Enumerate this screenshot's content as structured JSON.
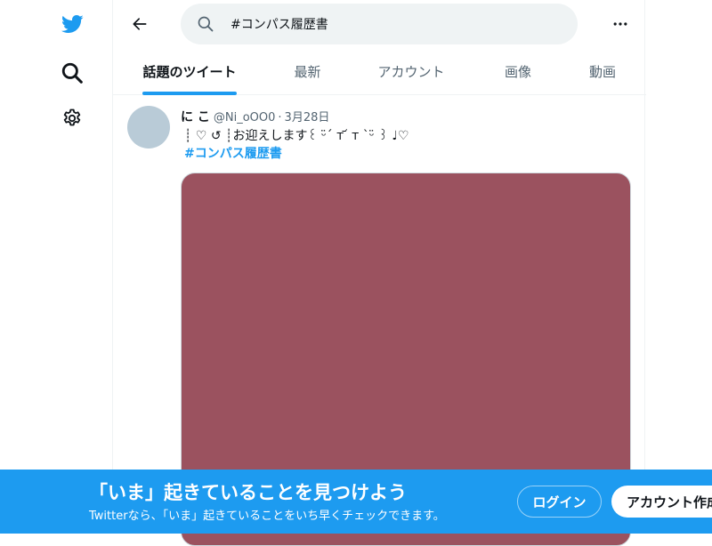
{
  "nav": {
    "icons": [
      "twitter-bird-logo",
      "explore-search-icon",
      "settings-gear-icon"
    ]
  },
  "search": {
    "query": "#コンパス履歴書"
  },
  "tabs": [
    {
      "label": "話題のツイート",
      "active": true
    },
    {
      "label": "最新",
      "active": false
    },
    {
      "label": "アカウント",
      "active": false
    },
    {
      "label": "画像",
      "active": false
    },
    {
      "label": "動画",
      "active": false
    }
  ],
  "tweet": {
    "display_name": "に こ",
    "handle": "@Ni_oOO0",
    "separator": "·",
    "date": "3月28日",
    "text": "┊ ♡ ↺ ┊お迎えします꒰ ᵕ̈ˊ т ᷄ т ˋᵕ̈ ꒱ ♩♡",
    "hashtag": "#コンパス履歴書",
    "media_color": "#9b525f"
  },
  "bottom_bar": {
    "headline": "「いま」起きていることを見つけよう",
    "subline": "Twitterなら、「いま」起きていることをいち早くチェックできます。",
    "login_label": "ログイン",
    "signup_label": "アカウント作成",
    "background": "#1d9bf0"
  },
  "colors": {
    "accent": "#1d9bf0",
    "text_primary": "#0f1419",
    "text_secondary": "#536471"
  }
}
